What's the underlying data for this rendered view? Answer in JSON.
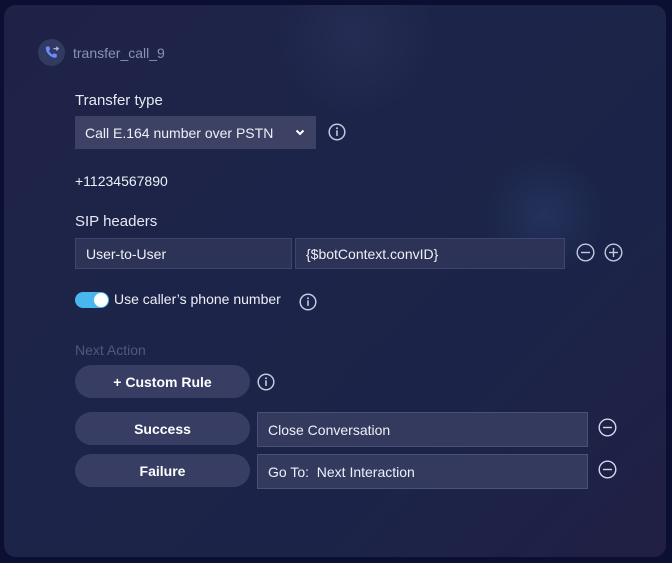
{
  "header": {
    "icon": "phone-transfer-icon",
    "title": "transfer_call_9"
  },
  "transfer_type": {
    "label": "Transfer type",
    "selected": "Call E.164 number over PSTN",
    "info_icon": "info-icon"
  },
  "phone_number": "+11234567890",
  "sip_headers": {
    "label": "SIP headers",
    "rows": [
      {
        "name": "User-to-User",
        "value": "{$botContext.convID}"
      }
    ]
  },
  "caller_phone": {
    "label": "Use caller’s phone number",
    "enabled": true
  },
  "next_action": {
    "label": "Next Action",
    "custom_rule_label": "+ Custom Rule",
    "rules": [
      {
        "condition": "Success",
        "action": "Close Conversation"
      },
      {
        "condition": "Failure",
        "action": "Go To:  Next Interaction"
      }
    ]
  },
  "colors": {
    "toggle_on": "#49b6ee",
    "accent_icon": "#6b8cff"
  }
}
